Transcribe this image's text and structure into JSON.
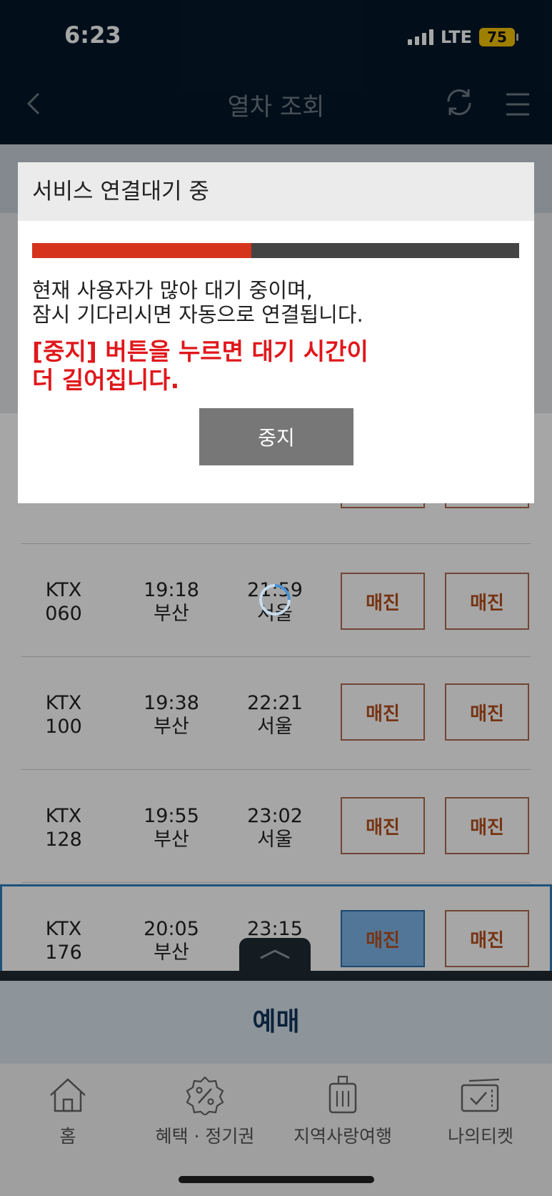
{
  "status_bar": {
    "time": "6:23",
    "network": "LTE",
    "battery": "75"
  },
  "header": {
    "title": "열차 조회"
  },
  "trains": [
    {
      "train": [
        "KTX",
        "060"
      ],
      "dep_time": "19:18",
      "dep_station": "부산",
      "arr_time": "21:59",
      "arr_station": "서울",
      "seat1": "매진",
      "seat2": "매진"
    },
    {
      "train": [
        "KTX",
        "100"
      ],
      "dep_time": "19:38",
      "dep_station": "부산",
      "arr_time": "22:21",
      "arr_station": "서울",
      "seat1": "매진",
      "seat2": "매진"
    },
    {
      "train": [
        "KTX",
        "128"
      ],
      "dep_time": "19:55",
      "dep_station": "부산",
      "arr_time": "23:02",
      "arr_station": "서울",
      "seat1": "매진",
      "seat2": "매진"
    },
    {
      "train": [
        "KTX",
        "176"
      ],
      "dep_time": "20:05",
      "dep_station": "부산",
      "arr_time": "23:15",
      "arr_station": "",
      "seat1": "매진",
      "seat2": "매진"
    }
  ],
  "reserve_label": "예매",
  "tabs": [
    {
      "label": "홈",
      "icon": "home-icon"
    },
    {
      "label": "혜택 · 정기권",
      "icon": "discount-icon"
    },
    {
      "label": "지역사랑여행",
      "icon": "luggage-icon"
    },
    {
      "label": "나의티켓",
      "icon": "ticket-icon"
    }
  ],
  "modal": {
    "title": "서비스 연결대기 중",
    "progress": 0.45,
    "message_line1": "현재 사용자가 많아 대기 중이며,",
    "message_line2": "잠시 기다리시면 자동으로 연결됩니다.",
    "warning_line1": "[중지] 버튼을 누르면 대기 시간이",
    "warning_line2": "더 길어집니다.",
    "stop_label": "중지"
  },
  "colors": {
    "progress_fill": "#d5331c",
    "progress_track": "#444444",
    "warning": "#e0171b",
    "header_bg": "#041829"
  }
}
